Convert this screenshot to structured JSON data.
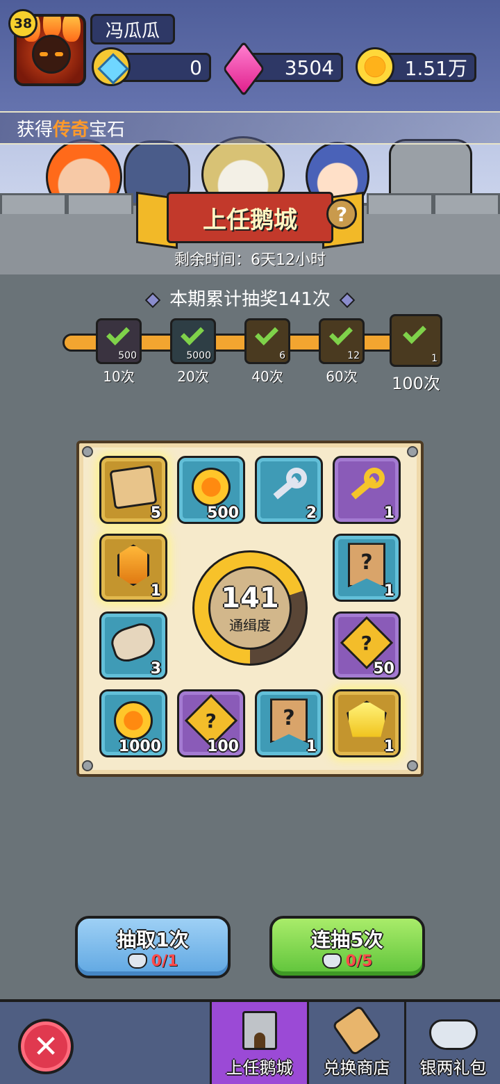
{
  "player": {
    "level": "38",
    "name": "冯瓜瓜"
  },
  "currencies": {
    "blue_gem": "0",
    "pink_gem": "3504",
    "gold": "1.51万"
  },
  "ticker": {
    "prefix": "获得",
    "highlight": "传奇",
    "suffix": "宝石"
  },
  "event": {
    "title": "上任鹅城",
    "remaining": "剩余时间：6天12小时",
    "total_draws": "本期累计抽奖141次"
  },
  "milestones": [
    {
      "count": "500",
      "label": "10次"
    },
    {
      "count": "5000",
      "label": "20次"
    },
    {
      "count": "6",
      "label": "40次"
    },
    {
      "count": "12",
      "label": "60次"
    },
    {
      "count": "1",
      "label": "100次"
    }
  ],
  "prizes": {
    "scroll": "5",
    "coin_500": "500",
    "silver_key": "2",
    "gold_key": "1",
    "amber": "1",
    "banner_a": "1",
    "rune": "3",
    "puzzle_50": "50",
    "coin_1000": "1000",
    "puzzle_100": "100",
    "banner_b": "1",
    "yellow_gem": "1"
  },
  "dial": {
    "value": "141",
    "label": "通缉度",
    "fill_fraction": 0.7
  },
  "buttons": {
    "draw_one": "抽取1次",
    "draw_one_cost": "0/1",
    "draw_five": "连抽5次",
    "draw_five_cost": "0/5"
  },
  "nav": {
    "tab_city": "上任鹅城",
    "tab_shop": "兑换商店",
    "tab_gift": "银两礼包"
  },
  "colors": {
    "accent": "#9b4ad6",
    "legendary": "#ff9a2a",
    "progress": "#f2a530"
  }
}
